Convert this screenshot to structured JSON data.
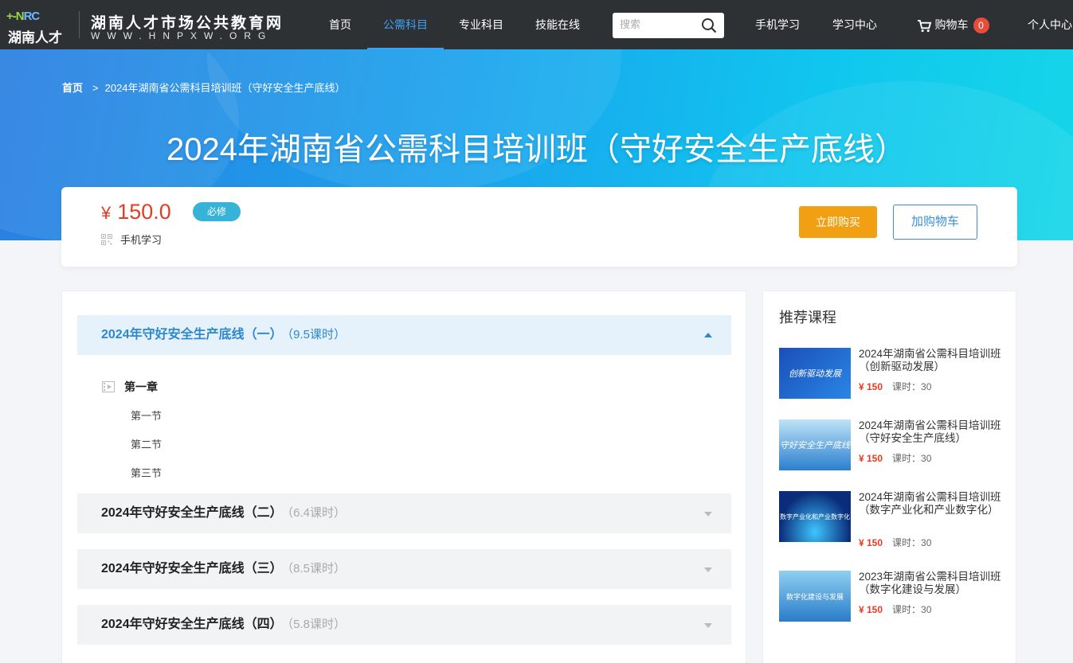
{
  "logo": {
    "mark_left": "+-N",
    "mark_right": "RC",
    "name": "湖南人才"
  },
  "site": {
    "title": "湖南人才市场公共教育网",
    "url": "WWW.HNPXW.ORG"
  },
  "nav": {
    "items": [
      {
        "label": "首页"
      },
      {
        "label": "公需科目"
      },
      {
        "label": "专业科目"
      },
      {
        "label": "技能在线"
      }
    ],
    "search_placeholder": "搜索",
    "mobile": "手机学习",
    "study_center": "学习中心",
    "cart_label": "购物车",
    "cart_count": "0",
    "profile": "个人中心"
  },
  "breadcrumb": {
    "home": "首页",
    "sep": ">",
    "current": "2024年湖南省公需科目培训班（守好安全生产底线）"
  },
  "page_title": "2024年湖南省公需科目培训班（守好安全生产底线）",
  "course": {
    "currency": "¥",
    "price": "150.0",
    "badge": "必修",
    "mobile_label": "手机学习",
    "buy_label": "立即购买",
    "cart_label": "加购物车"
  },
  "sections": [
    {
      "title": "2024年守好安全生产底线（一）",
      "hours": "（9.5课时）",
      "open": true
    },
    {
      "title": "2024年守好安全生产底线（二）",
      "hours": "（6.4课时）",
      "open": false
    },
    {
      "title": "2024年守好安全生产底线（三）",
      "hours": "（8.5课时）",
      "open": false
    },
    {
      "title": "2024年守好安全生产底线（四）",
      "hours": "（5.8课时）",
      "open": false
    }
  ],
  "chapter": {
    "title": "第一章",
    "lessons": [
      "第一节",
      "第二节",
      "第三节"
    ]
  },
  "recommend": {
    "title": "推荐课程",
    "items": [
      {
        "name": "2024年湖南省公需科目培训班（创新驱动发展）",
        "thumb_text": "创新驱动发展",
        "price": "¥  150",
        "hours": "课时：30",
        "color": "#1a4fb8"
      },
      {
        "name": "2024年湖南省公需科目培训班（守好安全生产底线）",
        "thumb_text": "守好安全生产底线",
        "price": "¥  150",
        "hours": "课时：30",
        "color": "#3a8fd6"
      },
      {
        "name": "2024年湖南省公需科目培训班（数字产业化和产业数字化）",
        "thumb_text": "数字产业化和产业数字化",
        "price": "¥  150",
        "hours": "课时：30",
        "color": "#0a2c7a"
      },
      {
        "name": "2023年湖南省公需科目培训班（数字化建设与发展）",
        "thumb_text": "数字化建设与发展",
        "price": "¥  150",
        "hours": "课时：30",
        "color": "#2a7cc8"
      }
    ]
  }
}
